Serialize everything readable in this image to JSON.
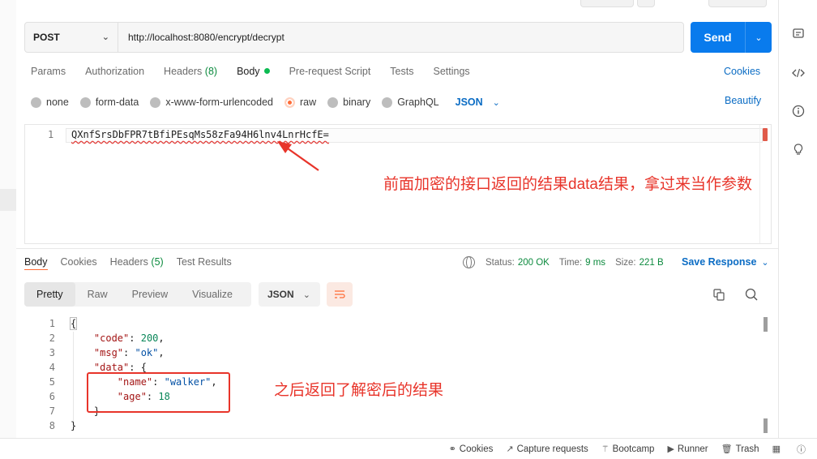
{
  "request": {
    "method": "POST",
    "url": "http://localhost:8080/encrypt/decrypt",
    "send_label": "Send"
  },
  "request_tabs": [
    {
      "label": "Params"
    },
    {
      "label": "Authorization"
    },
    {
      "label": "Headers",
      "count": "(8)"
    },
    {
      "label": "Body"
    },
    {
      "label": "Pre-request Script"
    },
    {
      "label": "Tests"
    },
    {
      "label": "Settings"
    }
  ],
  "cookies_link": "Cookies",
  "body_types": [
    "none",
    "form-data",
    "x-www-form-urlencoded",
    "raw",
    "binary",
    "GraphQL"
  ],
  "body_selected": "raw",
  "body_format": "JSON",
  "beautify_label": "Beautify",
  "request_body": {
    "line_number": "1",
    "text": "QXnfSrsDbFPR7tBfiPEsqMs58zFa94H6lnv4LnrHcfE="
  },
  "annotations": {
    "request_note": "前面加密的接口返回的结果data结果，拿过来当作参数",
    "response_note": "之后返回了解密后的结果"
  },
  "response_tabs": [
    {
      "label": "Body"
    },
    {
      "label": "Cookies"
    },
    {
      "label": "Headers",
      "count": "(5)"
    },
    {
      "label": "Test Results"
    }
  ],
  "status": {
    "status_key": "Status:",
    "status_val": "200 OK",
    "time_key": "Time:",
    "time_val": "9 ms",
    "size_key": "Size:",
    "size_val": "221 B"
  },
  "save_response_label": "Save Response",
  "view_tabs": [
    "Pretty",
    "Raw",
    "Preview",
    "Visualize"
  ],
  "response_format": "JSON",
  "response_body": {
    "line_numbers": [
      "1",
      "2",
      "3",
      "4",
      "5",
      "6",
      "7",
      "8"
    ],
    "lines": [
      {
        "indent": "",
        "key": "",
        "punc": "{",
        "value": "",
        "vtype": ""
      },
      {
        "indent": "    ",
        "key": "\"code\"",
        "punc": ": ",
        "value": "200",
        "vtype": "num",
        "tail": ","
      },
      {
        "indent": "    ",
        "key": "\"msg\"",
        "punc": ": ",
        "value": "\"ok\"",
        "vtype": "str",
        "tail": ","
      },
      {
        "indent": "    ",
        "key": "\"data\"",
        "punc": ": {",
        "value": "",
        "vtype": ""
      },
      {
        "indent": "        ",
        "key": "\"name\"",
        "punc": ": ",
        "value": "\"walker\"",
        "vtype": "str",
        "tail": ","
      },
      {
        "indent": "        ",
        "key": "\"age\"",
        "punc": ": ",
        "value": "18",
        "vtype": "num"
      },
      {
        "indent": "    ",
        "key": "",
        "punc": "}",
        "value": "",
        "vtype": ""
      },
      {
        "indent": "",
        "key": "",
        "punc": "}",
        "value": "",
        "vtype": ""
      }
    ]
  },
  "footer": [
    {
      "label": "Cookies",
      "icon": "cookie-icon"
    },
    {
      "label": "Capture requests",
      "icon": "capture-icon"
    },
    {
      "label": "Bootcamp",
      "icon": "bootcamp-icon"
    },
    {
      "label": "Runner",
      "icon": "runner-icon"
    },
    {
      "label": "Trash",
      "icon": "trash-icon"
    }
  ],
  "colors": {
    "accent": "#ff6c37",
    "send_blue": "#097bed",
    "link_blue": "#0b6cc4",
    "status_green": "#0c8a3e",
    "annotation_red": "#e8342a"
  }
}
